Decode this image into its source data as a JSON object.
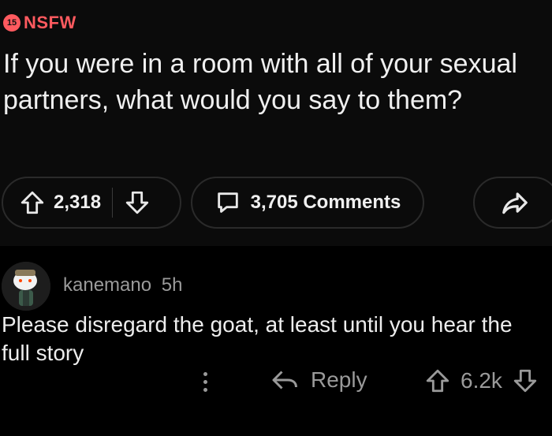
{
  "post": {
    "nsfw_count": "15",
    "nsfw_label": "NSFW",
    "title": "If you were in a room with all of your sexual partners, what would you say to them?",
    "score": "2,318",
    "comments_label": "3,705 Comments",
    "icons": {
      "upvote": "arrow-up-icon",
      "downvote": "arrow-down-icon",
      "comments": "speech-bubble-icon",
      "share": "share-arrow-icon"
    }
  },
  "comment": {
    "username": "kanemano",
    "age": "5h",
    "text": "Please disregard the goat, at least until you hear the full story",
    "reply_label": "Reply",
    "score": "6.2k",
    "icons": {
      "more": "more-vertical-icon",
      "reply": "reply-arrow-icon",
      "upvote": "arrow-up-icon",
      "downvote": "arrow-down-icon"
    }
  },
  "colors": {
    "accent_nsfw": "#ff5a5f",
    "background": "#000000",
    "post_background": "#0b0b0b",
    "muted_text": "#9a9a9a"
  }
}
